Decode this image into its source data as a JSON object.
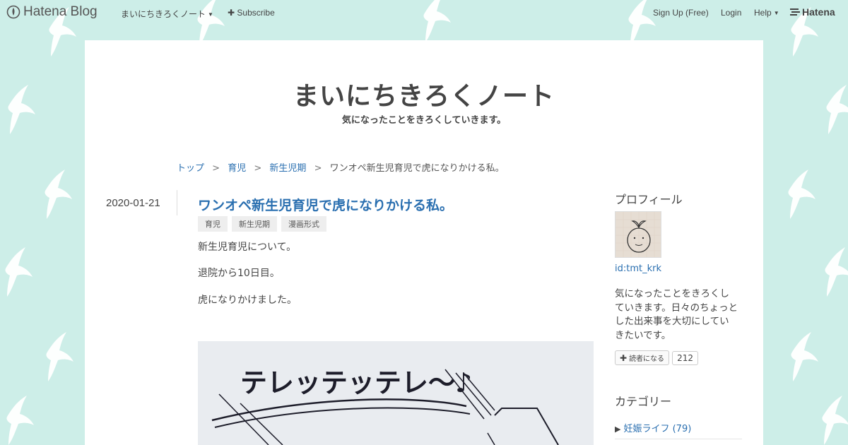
{
  "topbar": {
    "logo_text": "Hatena Blog",
    "blog_menu": "まいにちきろくノート",
    "subscribe": "Subscribe",
    "signup": "Sign Up (Free)",
    "login": "Login",
    "help": "Help",
    "hatena": "Hatena"
  },
  "blog": {
    "title": "まいにちきろくノート",
    "tagline": "気になったことをきろくしていきます。"
  },
  "breadcrumb": {
    "items": [
      "トップ",
      "育児",
      "新生児期"
    ],
    "current": "ワンオペ新生児育児で虎になりかける私。",
    "sep": ">"
  },
  "entry": {
    "date": "2020-01-21",
    "title": "ワンオペ新生児育児で虎になりかける私。",
    "tags": [
      "育児",
      "新生児期",
      "漫画形式"
    ],
    "paragraphs": [
      "新生児育児について。",
      "退院から10日目。",
      "虎になりかけました。"
    ],
    "image_text": "テレッテッテレ〜♪"
  },
  "sidebar": {
    "profile_heading": "プロフィール",
    "user_id": "id:tmt_krk",
    "bio": "気になったことをきろくしていきます。日々のちょっとした出来事を大切にしていきたいです。",
    "reader_button": "読者になる",
    "reader_count": "212",
    "category_heading": "カテゴリー",
    "categories": [
      {
        "label": "妊娠ライフ (79)"
      }
    ]
  },
  "colors": {
    "background": "#cdeee8",
    "link": "#2a6fb0",
    "text": "#444444"
  }
}
